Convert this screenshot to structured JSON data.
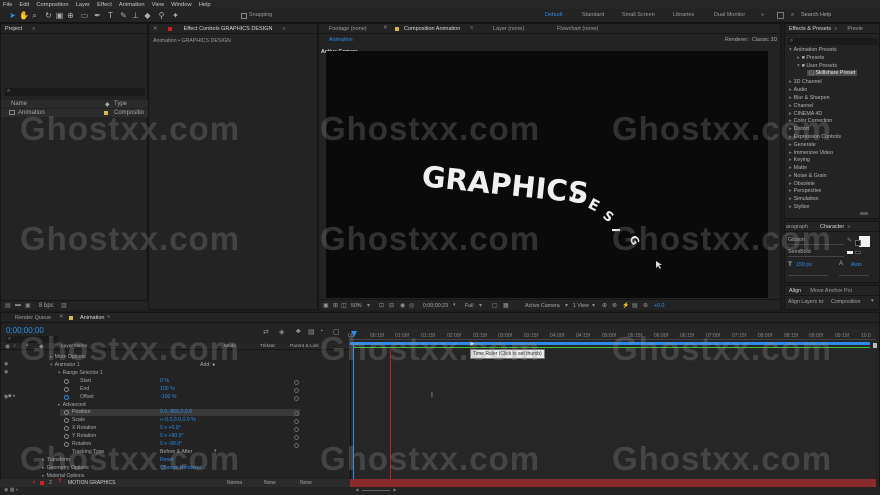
{
  "menu": [
    "File",
    "Edit",
    "Composition",
    "Layer",
    "Effect",
    "Animation",
    "View",
    "Window",
    "Help"
  ],
  "toolbar": {
    "snapping_label": "Snapping",
    "workspaces": [
      "Default",
      "Standard",
      "Small Screen",
      "Libraries",
      "Dual Monitor"
    ],
    "search_placeholder": "Search Help"
  },
  "project_panel": {
    "title": "Project",
    "col_name": "Name",
    "col_type": "Type",
    "item_name": "Animation",
    "item_type": "Compositio",
    "bpc": "8 bpc"
  },
  "effect_controls": {
    "tab": "Effect Controls GRAPHICS DESIGN",
    "subtitle": "Animation • GRAPHICS DESIGN"
  },
  "comp_tabs": {
    "footage": "Footage (none)",
    "composition": "Composition Animation",
    "layer": "Layer (none)",
    "flowchart": "Flowchart (none)",
    "subtab": "Animation",
    "renderer": "Renderer:",
    "renderer_value": "Classic 3D",
    "active_camera": "Active Camera"
  },
  "viewer_text": {
    "main": "GRAPHICS",
    "word2": [
      "D",
      "E",
      "S",
      "I",
      "G"
    ]
  },
  "viewer_footer": {
    "zoom": "50%",
    "timecode": "0;00;00;23",
    "quality": "Full",
    "camera": "Active Camera",
    "views": "1 View",
    "offset": "+0.0"
  },
  "effects_presets": {
    "tab": "Effects & Presets",
    "tab2": "Previe",
    "items": [
      "Animation Presets",
      "Presets",
      "User Presets",
      "Skillshare Preset",
      "3D Channel",
      "Audio",
      "Blur & Sharpen",
      "Channel",
      "CINEMA 4D",
      "Color Correction",
      "Distort",
      "Expression Controls",
      "Generate",
      "Immersive Video",
      "Keying",
      "Matte",
      "Noise & Grain",
      "Obsolete",
      "Perspective",
      "Simulation",
      "Stylize"
    ]
  },
  "character": {
    "tab_para": "aragraph",
    "tab": "Character",
    "font": "Gibson",
    "style": "SemiBold",
    "size": "150 px",
    "leading": "Auto"
  },
  "align": {
    "tab": "Align",
    "tab2": "Move Anchor Poi",
    "align_to_label": "Align Layers to:",
    "align_to_value": "Composition"
  },
  "timeline": {
    "render_tab": "Render Queue",
    "comp_tab": "Animation",
    "timecode": "0;00;00;00",
    "tooltip": "Time Ruler (Click to set thumb)",
    "headers": [
      "Layer Name",
      "Mode",
      "TrkMat",
      "Parent & Link"
    ],
    "ticks": [
      "00f",
      "00:15f",
      "01:00f",
      "01:15f",
      "02:00f",
      "02:15f",
      "03:00f",
      "03:15f",
      "04:00f",
      "04:15f",
      "05:00f",
      "05:15f",
      "06:00f",
      "06:15f",
      "07:00f",
      "07:15f",
      "08:00f",
      "08:15f",
      "09:00f",
      "09:15f",
      "10:0"
    ],
    "rows": [
      {
        "label": "More Options",
        "indent": 0
      },
      {
        "label": "Animator 1",
        "indent": 1,
        "extra": "Add:"
      },
      {
        "label": "Range Selector 1",
        "indent": 2
      },
      {
        "label": "Start",
        "indent": 3,
        "value": "0 %"
      },
      {
        "label": "End",
        "indent": 3,
        "value": "100 %"
      },
      {
        "label": "Offset",
        "indent": 3,
        "value": "-100 %"
      },
      {
        "label": "Advanced",
        "indent": 2
      },
      {
        "label": "Position",
        "indent": 2,
        "value": "0.0,-856.0,0.0"
      },
      {
        "label": "Scale",
        "indent": 2,
        "value": "∞ 0.0,0.0,0.0 %"
      },
      {
        "label": "X Rotation",
        "indent": 2,
        "value": "0 x +0.0°"
      },
      {
        "label": "Y Rotation",
        "indent": 2,
        "value": "0 x +90.0°"
      },
      {
        "label": "Rotation",
        "indent": 2,
        "value": "0 x -90.0°"
      },
      {
        "label": "Tracking Type",
        "indent": 2,
        "value": "Before & After"
      },
      {
        "label": "Transform",
        "indent": 0,
        "value": "Reset"
      },
      {
        "label": "Geometry Options",
        "indent": 0,
        "value": "Change Renderer..."
      },
      {
        "label": "Material Options",
        "indent": 0
      }
    ],
    "layer_row": {
      "num": "2",
      "name": "MOTION GRAPHICS",
      "mode": "Norma",
      "trkmat": "None",
      "parent": "None"
    }
  },
  "watermark": "Ghostxx.com"
}
